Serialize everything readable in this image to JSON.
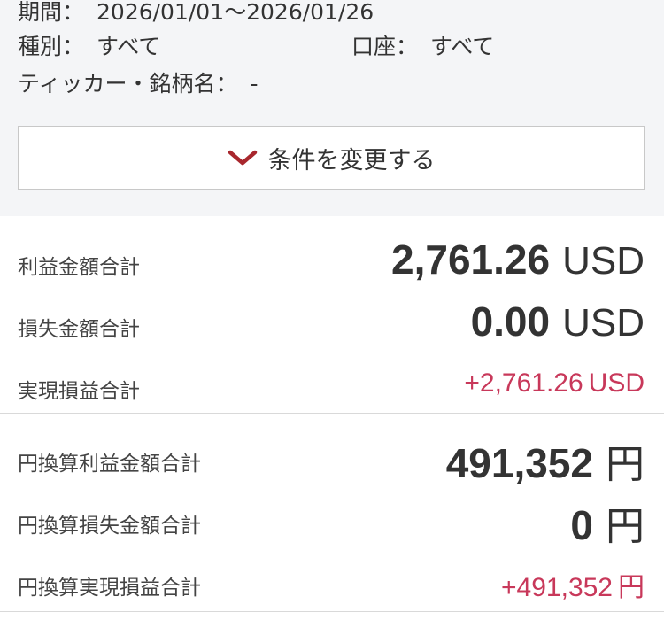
{
  "filters": {
    "period_label": "期間：",
    "period_value": "2026/01/01～2026/01/26",
    "type_label": "種別：",
    "type_value": "すべて",
    "account_label": "口座：",
    "account_value": "すべて",
    "ticker_label": "ティッカー・銘柄名：",
    "ticker_value": "-"
  },
  "change_button": {
    "icon": "chevron-down-icon",
    "label": "条件を変更する",
    "accent_color": "#a8272d"
  },
  "usd_summary": {
    "profit_label": "利益金額合計",
    "profit_value": "2,761.26",
    "profit_unit": "USD",
    "loss_label": "損失金額合計",
    "loss_value": "0.00",
    "loss_unit": "USD",
    "realized_label": "実現損益合計",
    "realized_value": "+2,761.26",
    "realized_unit": "USD"
  },
  "jpy_summary": {
    "profit_label": "円換算利益金額合計",
    "profit_value": "491,352",
    "profit_unit": "円",
    "loss_label": "円換算損失金額合計",
    "loss_value": "0",
    "loss_unit": "円",
    "realized_label": "円換算実現損益合計",
    "realized_value": "+491,352",
    "realized_unit": "円"
  },
  "colors": {
    "positive": "#c8385a",
    "text": "#333333",
    "filter_background": "#f4f5f7"
  }
}
